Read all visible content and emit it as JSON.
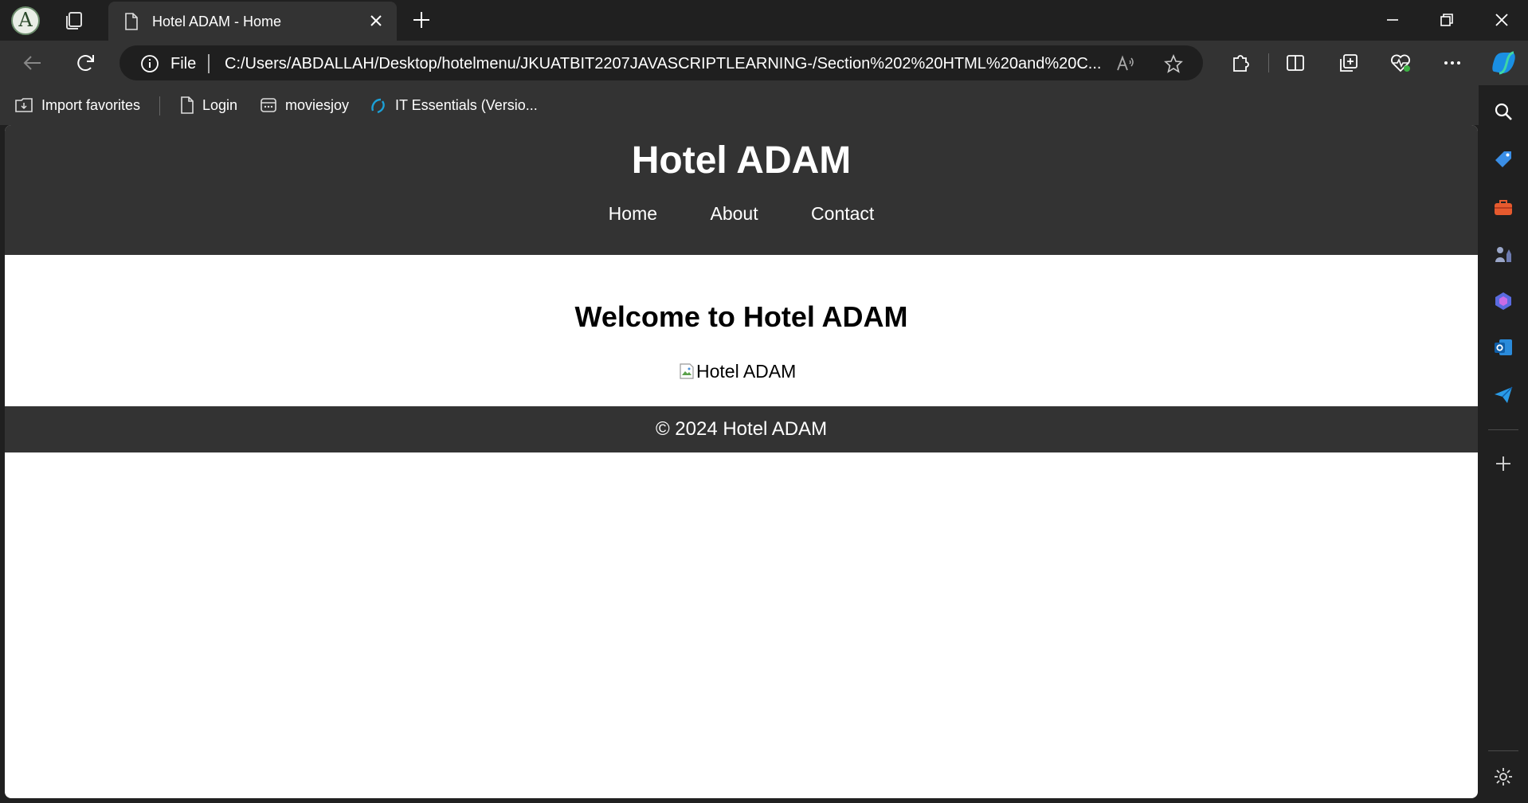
{
  "browser": {
    "profile_initial": "A",
    "tab": {
      "title": "Hotel ADAM - Home"
    },
    "address": {
      "scheme": "File",
      "url": "C:/Users/ABDALLAH/Desktop/hotelmenu/JKUATBIT2207JAVASCRIPTLEARNING-/Section%202%20HTML%20and%20C..."
    },
    "favorites": [
      {
        "label": "Import favorites",
        "icon": "import-favorites-icon"
      },
      {
        "label": "Login",
        "icon": "page-icon"
      },
      {
        "label": "moviesjoy",
        "icon": "page-icon"
      },
      {
        "label": "IT Essentials (Versio...",
        "icon": "cisco-icon"
      }
    ],
    "accent": "#0078d4"
  },
  "page": {
    "header": {
      "title": "Hotel ADAM",
      "nav": [
        "Home",
        "About",
        "Contact"
      ]
    },
    "main": {
      "heading": "Welcome to Hotel ADAM",
      "image_alt": "Hotel ADAM"
    },
    "footer": {
      "text": "© 2024 Hotel ADAM"
    },
    "colors": {
      "header_bg": "#333333",
      "footer_bg": "#333333",
      "body_bg": "#ffffff"
    }
  }
}
